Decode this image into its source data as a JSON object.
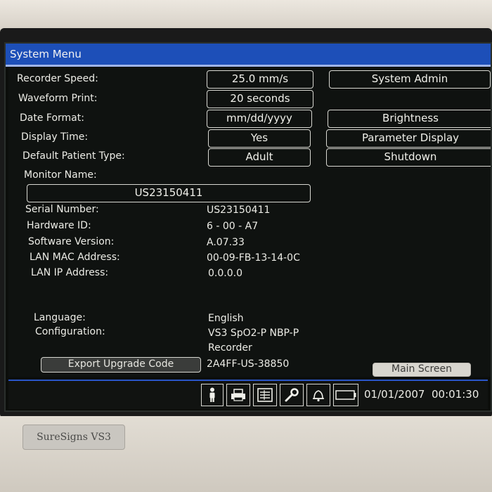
{
  "window": {
    "title": "System Menu"
  },
  "settings": {
    "recorder_speed": {
      "label": "Recorder Speed:",
      "value": "25.0 mm/s"
    },
    "waveform_print": {
      "label": "Waveform Print:",
      "value": "20 seconds"
    },
    "date_format": {
      "label": "Date Format:",
      "value": "mm/dd/yyyy"
    },
    "display_time": {
      "label": "Display Time:",
      "value": "Yes"
    },
    "default_patient_type": {
      "label": "Default Patient Type:",
      "value": "Adult"
    },
    "monitor_name": {
      "label": "Monitor Name:",
      "value": "US23150411"
    }
  },
  "side_buttons": {
    "system_admin": "System Admin",
    "brightness": "Brightness",
    "parameter_display": "Parameter Display",
    "shutdown": "Shutdown"
  },
  "info": {
    "serial_number": {
      "label": "Serial Number:",
      "value": "US23150411"
    },
    "hardware_id": {
      "label": "Hardware ID:",
      "value": "6 - 00 - A7"
    },
    "software_version": {
      "label": "Software Version:",
      "value": "A.07.33"
    },
    "lan_mac": {
      "label": "LAN MAC Address:",
      "value": "00-09-FB-13-14-0C"
    },
    "lan_ip": {
      "label": "LAN IP Address:",
      "value": "0.0.0.0"
    },
    "language": {
      "label": "Language:",
      "value": "English"
    },
    "configuration": {
      "label": "Configuration:",
      "value_line1": "VS3 SpO2-P NBP-P",
      "value_line2": "Recorder"
    }
  },
  "export": {
    "button": "Export Upgrade Code",
    "code": "2A4FF-US-38850"
  },
  "main_screen_button": "Main Screen",
  "status_bar": {
    "icons": [
      "patient-icon",
      "printer-icon",
      "trends-icon",
      "tools-icon",
      "alarm-bell-icon",
      "battery-icon"
    ],
    "date": "01/01/2007",
    "time": "00:01:30"
  },
  "device": {
    "brand": "SureSigns VS3"
  }
}
